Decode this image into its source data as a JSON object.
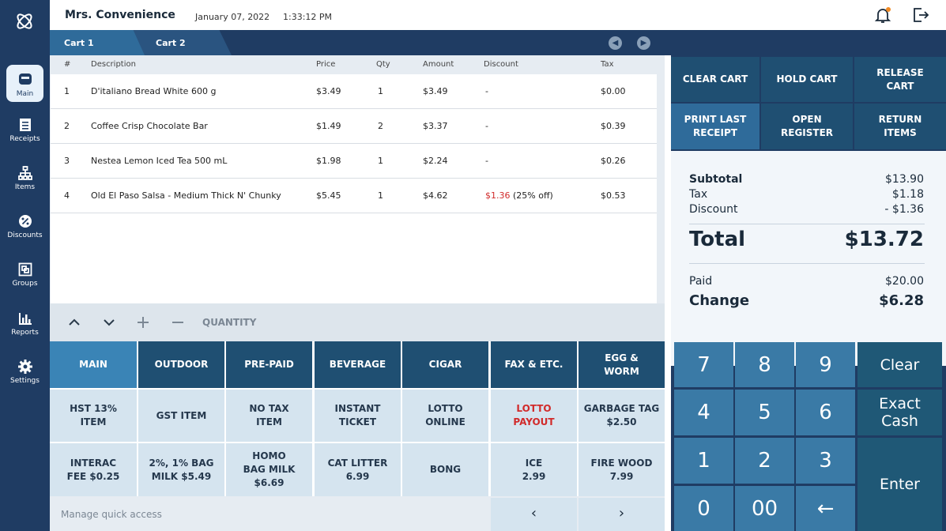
{
  "app": {
    "title": "Mrs. Convenience",
    "date": "January 07, 2022",
    "time": "1:33:12 PM"
  },
  "sidebar": {
    "items": [
      {
        "label": "Main",
        "icon": "register-icon"
      },
      {
        "label": "Receipts",
        "icon": "receipt-icon"
      },
      {
        "label": "Items",
        "icon": "hierarchy-icon"
      },
      {
        "label": "Discounts",
        "icon": "discount-icon"
      },
      {
        "label": "Groups",
        "icon": "groups-icon"
      },
      {
        "label": "Reports",
        "icon": "chart-icon"
      },
      {
        "label": "Settings",
        "icon": "gear-icon"
      }
    ]
  },
  "tabs": [
    {
      "label": "Cart 1"
    },
    {
      "label": "Cart 2"
    }
  ],
  "table": {
    "headers": [
      "#",
      "Description",
      "Price",
      "Qty",
      "Amount",
      "Discount",
      "Tax"
    ],
    "rows": [
      {
        "num": "1",
        "desc": "D'italiano Bread White 600 g",
        "price": "$3.49",
        "qty": "1",
        "amount": "$3.49",
        "discount": "-",
        "discount_note": "",
        "tax": "$0.00"
      },
      {
        "num": "2",
        "desc": "Coffee Crisp Chocolate Bar",
        "price": "$1.49",
        "qty": "2",
        "amount": "$3.37",
        "discount": "-",
        "discount_note": "",
        "tax": "$0.39"
      },
      {
        "num": "3",
        "desc": "Nestea Lemon Iced Tea 500 mL",
        "price": "$1.98",
        "qty": "1",
        "amount": "$2.24",
        "discount": "-",
        "discount_note": "",
        "tax": "$0.26"
      },
      {
        "num": "4",
        "desc": "Old El Paso Salsa - Medium Thick N' Chunky",
        "price": "$5.45",
        "qty": "1",
        "amount": "$4.62",
        "discount": "$1.36",
        "discount_note": "(25% off)",
        "tax": "$0.53"
      }
    ]
  },
  "quantity_bar": {
    "label": "QUANTITY"
  },
  "categories": [
    "MAIN",
    "OUTDOOR",
    "PRE-PAID",
    "BEVERAGE",
    "CIGAR",
    "FAX & ETC.",
    "EGG & WORM"
  ],
  "quick_keys": [
    [
      "HST 13% ITEM",
      "GST ITEM",
      "NO TAX ITEM",
      "INSTANT TICKET",
      "LOTTO ONLINE",
      "LOTTO PAYOUT",
      "GARBAGE TAG $2.50"
    ],
    [
      "INTERAC FEE $0.25",
      "2%, 1% BAG MILK $5.49",
      "HOMO BAG MILK $6.69",
      "CAT LITTER 6.99",
      "BONG",
      "ICE 2.99",
      "FIRE WOOD 7.99"
    ]
  ],
  "quick_footer": {
    "label": "Manage quick access",
    "prev": "‹",
    "next": "›"
  },
  "actions": [
    "CLEAR CART",
    "HOLD CART",
    "RELEASE CART",
    "PRINT LAST RECEIPT",
    "OPEN REGISTER",
    "RETURN ITEMS"
  ],
  "summary": {
    "subtotal_label": "Subtotal",
    "subtotal": "$13.90",
    "tax_label": "Tax",
    "tax": "$1.18",
    "discount_label": "Discount",
    "discount": "- $1.36",
    "total_label": "Total",
    "total": "$13.72",
    "paid_label": "Paid",
    "paid": "$20.00",
    "change_label": "Change",
    "change": "$6.28"
  },
  "keypad": {
    "digits": [
      "7",
      "8",
      "9",
      "4",
      "5",
      "6",
      "1",
      "2",
      "3",
      "0",
      "00",
      "←"
    ],
    "clear": "Clear",
    "exact": "Exact Cash",
    "enter": "Enter"
  },
  "colors": {
    "sidebar": "#1f3c63",
    "accent": "#3a84b6",
    "discount_red": "#d12b2b"
  }
}
